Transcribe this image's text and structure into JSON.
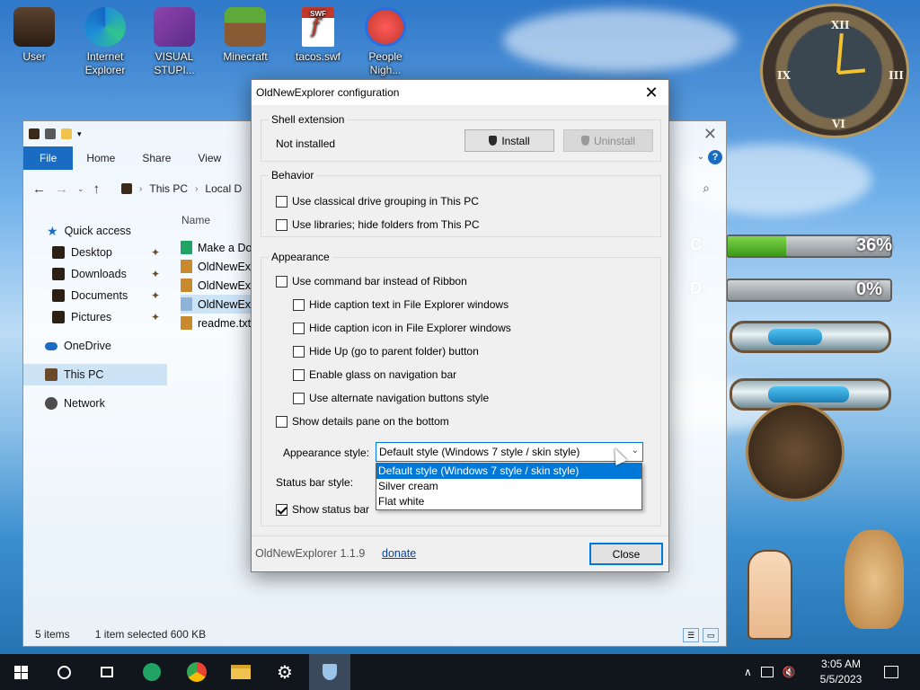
{
  "desktop": {
    "icons": [
      {
        "label": "User"
      },
      {
        "label": "Internet Explorer"
      },
      {
        "label": "VISUAL STUPI..."
      },
      {
        "label": "Minecraft"
      },
      {
        "label": "tacos.swf"
      },
      {
        "label": "People Nigh..."
      }
    ],
    "drives": [
      {
        "letter": "C:",
        "percent": "36%",
        "fill": 0.36
      },
      {
        "letter": "D:",
        "percent": "0%",
        "fill": 0.0
      }
    ]
  },
  "explorer": {
    "ribbon_tabs": [
      "File",
      "Home",
      "Share",
      "View"
    ],
    "breadcrumb": [
      "This PC",
      "Local D"
    ],
    "column_name": "Name",
    "nav": [
      {
        "label": "Quick access"
      },
      {
        "label": "Desktop"
      },
      {
        "label": "Downloads"
      },
      {
        "label": "Documents"
      },
      {
        "label": "Pictures"
      },
      {
        "label": "OneDrive"
      },
      {
        "label": "This PC"
      },
      {
        "label": "Network"
      }
    ],
    "files": [
      {
        "name": "Make a Do"
      },
      {
        "name": "OldNewEx"
      },
      {
        "name": "OldNewEx"
      },
      {
        "name": "OldNewEx"
      },
      {
        "name": "readme.txt"
      }
    ],
    "status": {
      "items": "5 items",
      "selected": "1 item selected  600 KB"
    }
  },
  "dialog": {
    "title": "OldNewExplorer configuration",
    "shell": {
      "label": "Shell extension",
      "status": "Not installed",
      "install": "Install",
      "uninstall": "Uninstall"
    },
    "behavior": {
      "label": "Behavior",
      "options": [
        "Use classical drive grouping in This PC",
        "Use libraries; hide folders from This PC"
      ]
    },
    "appearance": {
      "label": "Appearance",
      "command_bar": "Use command bar instead of Ribbon",
      "sub_options": [
        "Hide caption text in File Explorer windows",
        "Hide caption icon in File Explorer windows",
        "Hide Up (go to parent folder) button",
        "Enable glass on navigation bar",
        "Use alternate navigation buttons style"
      ],
      "details_pane": "Show details pane on the bottom",
      "style_label": "Appearance style:",
      "style_value": "Default style (Windows 7 style / skin style)",
      "style_options": [
        "Default style (Windows 7 style / skin style)",
        "Silver cream",
        "Flat white"
      ],
      "status_bar_label": "Status bar style:",
      "show_status_bar": "Show status bar"
    },
    "footer": {
      "version": "OldNewExplorer 1.1.9",
      "donate": "donate",
      "close": "Close"
    }
  },
  "taskbar": {
    "time": "3:05 AM",
    "date": "5/5/2023"
  }
}
